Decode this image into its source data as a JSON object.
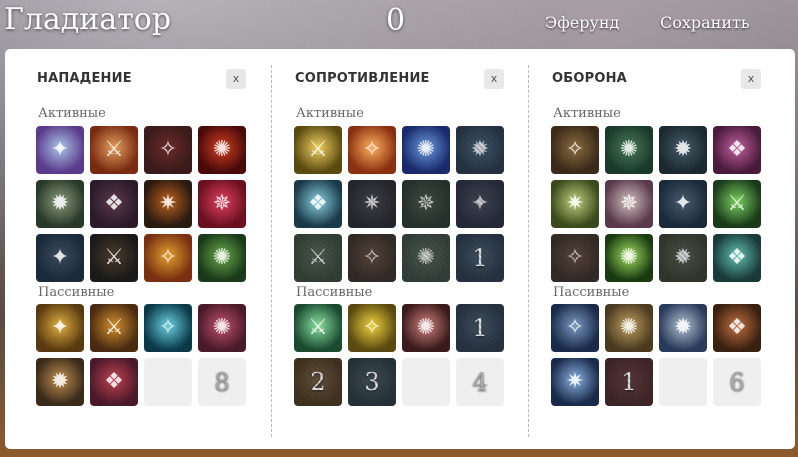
{
  "header": {
    "class_name": "Гладиатор",
    "points": "0",
    "server_link": "Эферунд",
    "save_link": "Сохранить"
  },
  "columns": [
    {
      "title": "НАПАДЕНИЕ",
      "close_label": "x",
      "active_label": "Активные",
      "passive_label": "Пассивные",
      "active": [
        {
          "icon": "lightning-slash-icon",
          "colors": [
            "#5a3a8a",
            "#a9c6e8"
          ]
        },
        {
          "icon": "sword-strike-icon",
          "colors": [
            "#7a2a10",
            "#e0a060"
          ]
        },
        {
          "icon": "blade-dash-icon",
          "colors": [
            "#3a1a1a",
            "#6a2a2a"
          ]
        },
        {
          "icon": "whirlwind-icon",
          "colors": [
            "#4a0a0a",
            "#d04020"
          ]
        },
        {
          "icon": "ground-slam-icon",
          "colors": [
            "#2a3a2a",
            "#8a9a7a"
          ]
        },
        {
          "icon": "shadow-strike-icon",
          "colors": [
            "#2a1a2a",
            "#5a3a4a"
          ]
        },
        {
          "icon": "flame-blade-icon",
          "colors": [
            "#2a1a10",
            "#c06020"
          ]
        },
        {
          "icon": "heart-vortex-icon",
          "colors": [
            "#6a1020",
            "#e04060"
          ]
        },
        {
          "icon": "dark-leap-icon",
          "colors": [
            "#1a2a3a",
            "#3a4a5a"
          ]
        },
        {
          "icon": "silhouette-icon",
          "colors": [
            "#1a1a1a",
            "#4a3a2a"
          ]
        },
        {
          "icon": "hammer-icon",
          "colors": [
            "#7a3010",
            "#e0a030"
          ]
        },
        {
          "icon": "green-warrior-icon",
          "colors": [
            "#1a3a1a",
            "#6aaa4a"
          ]
        }
      ],
      "passive": [
        {
          "icon": "golden-spear-icon",
          "colors": [
            "#5a3a10",
            "#e0b040"
          ]
        },
        {
          "icon": "golden-ring-icon",
          "colors": [
            "#4a2a10",
            "#d09030"
          ]
        },
        {
          "icon": "cyan-burst-icon",
          "colors": [
            "#0a3a4a",
            "#6ad0e0"
          ]
        },
        {
          "icon": "raised-sword-icon",
          "colors": [
            "#4a1a2a",
            "#c05070"
          ]
        },
        {
          "icon": "crossed-axes-icon",
          "colors": [
            "#3a2a1a",
            "#c09050"
          ]
        },
        {
          "icon": "fist-daggers-icon",
          "colors": [
            "#4a1a2a",
            "#c04050"
          ]
        },
        {
          "icon": "",
          "count": "",
          "empty": true
        },
        {
          "icon": "",
          "count": "8",
          "empty": true
        }
      ]
    },
    {
      "title": "СОПРОТИВЛЕНИЕ",
      "close_label": "x",
      "active_label": "Активные",
      "passive_label": "Пассивные",
      "active": [
        {
          "icon": "radiant-figure-icon",
          "colors": [
            "#5a4a10",
            "#f0d060"
          ]
        },
        {
          "icon": "sun-burst-icon",
          "colors": [
            "#8a3010",
            "#ffb060"
          ]
        },
        {
          "icon": "holy-shield-icon",
          "colors": [
            "#1a2a6a",
            "#6a9ae0"
          ]
        },
        {
          "icon": "dim-rays-icon",
          "colors": [
            "#1a2a3a",
            "#3a5a6a"
          ],
          "dim": true
        },
        {
          "icon": "electric-body-icon",
          "colors": [
            "#1a3a4a",
            "#8ad0e0"
          ]
        },
        {
          "icon": "head-silhouette-icon",
          "colors": [
            "#1a1a20",
            "#3a3a40"
          ],
          "dim": true
        },
        {
          "icon": "meditation-icon",
          "colors": [
            "#1a2a20",
            "#3a4a3a"
          ],
          "dim": true
        },
        {
          "icon": "dark-figure-icon",
          "colors": [
            "#1a2030",
            "#3a4050"
          ],
          "dim": true
        },
        {
          "icon": "green-mist-icon",
          "colors": [
            "#2a3a2a",
            "#4a5a4a"
          ],
          "dim": true
        },
        {
          "icon": "warrior-face-icon",
          "colors": [
            "#2a2018",
            "#5a4030"
          ],
          "dim": true
        },
        {
          "icon": "green-orb-icon",
          "colors": [
            "#2a3a30",
            "#4a5a4a"
          ],
          "dim": true
        },
        {
          "icon": "rays-one-icon",
          "colors": [
            "#1a2a3a",
            "#3a5060"
          ],
          "count": "1",
          "dim": true
        }
      ],
      "passive": [
        {
          "icon": "green-blade-icon",
          "colors": [
            "#1a4a30",
            "#8ae0a0"
          ]
        },
        {
          "icon": "yellow-slash-icon",
          "colors": [
            "#5a4a10",
            "#f0d040"
          ]
        },
        {
          "icon": "bandaged-hand-icon",
          "colors": [
            "#3a1a1a",
            "#d08080"
          ]
        },
        {
          "icon": "rays-icon",
          "colors": [
            "#1a2a3a",
            "#3a5060"
          ],
          "count": "1",
          "dim": true
        },
        {
          "icon": "dark-gold-icon",
          "colors": [
            "#3a2a10",
            "#6a5030"
          ],
          "count": "2",
          "dim": true
        },
        {
          "icon": "dark-teal-icon",
          "colors": [
            "#1a2a30",
            "#3a4a50"
          ],
          "count": "3",
          "dim": true
        },
        {
          "icon": "",
          "count": "",
          "empty": true
        },
        {
          "icon": "",
          "count": "4",
          "empty": true
        }
      ]
    },
    {
      "title": "ОБОРОНА",
      "close_label": "x",
      "active_label": "Активные",
      "passive_label": "Пассивные",
      "active": [
        {
          "icon": "tower-shield-icon",
          "colors": [
            "#3a2a1a",
            "#8a6a40"
          ]
        },
        {
          "icon": "arm-flex-icon",
          "colors": [
            "#1a3a2a",
            "#4a7a5a"
          ]
        },
        {
          "icon": "spear-thrower-icon",
          "colors": [
            "#1a2a30",
            "#4a5a6a"
          ]
        },
        {
          "icon": "dark-helm-icon",
          "colors": [
            "#4a1a3a",
            "#c060a0"
          ]
        },
        {
          "icon": "whip-icon",
          "colors": [
            "#3a4a1a",
            "#c0d080"
          ]
        },
        {
          "icon": "angel-shield-icon",
          "colors": [
            "#5a3a4a",
            "#d0c0c0"
          ]
        },
        {
          "icon": "javelin-icon",
          "colors": [
            "#1a2a3a",
            "#4a5a6a"
          ]
        },
        {
          "icon": "green-arrow-up-icon",
          "colors": [
            "#1a3a1a",
            "#7ad060"
          ]
        },
        {
          "icon": "brown-figure-icon",
          "colors": [
            "#2a2018",
            "#5a4030"
          ],
          "dim": true
        },
        {
          "icon": "glowing-figure-icon",
          "colors": [
            "#1a3a10",
            "#a0e060"
          ]
        },
        {
          "icon": "green-plate-icon",
          "colors": [
            "#2a3020",
            "#4a5040"
          ],
          "dim": true
        },
        {
          "icon": "flexing-man-icon",
          "colors": [
            "#1a3a3a",
            "#60c0b0"
          ]
        }
      ],
      "passive": [
        {
          "icon": "shield-icon",
          "colors": [
            "#1a2a4a",
            "#7a9ac0"
          ]
        },
        {
          "icon": "armor-row-icon",
          "colors": [
            "#4a3a20",
            "#c0a060"
          ]
        },
        {
          "icon": "round-shield-icon",
          "colors": [
            "#2a3a5a",
            "#b0c0d0"
          ]
        },
        {
          "icon": "brown-figure-icon",
          "colors": [
            "#3a2010",
            "#c07040"
          ]
        },
        {
          "icon": "wolf-roar-icon",
          "colors": [
            "#1a2a4a",
            "#8ab0e0"
          ]
        },
        {
          "icon": "dark-rays-icon",
          "colors": [
            "#3a1a1a",
            "#5a3030"
          ],
          "count": "1",
          "dim": true
        },
        {
          "icon": "",
          "count": "",
          "empty": true
        },
        {
          "icon": "",
          "count": "6",
          "empty": true
        }
      ]
    }
  ]
}
